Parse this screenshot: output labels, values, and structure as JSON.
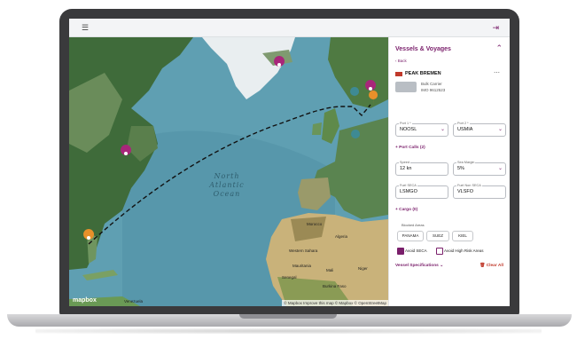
{
  "appbar": {
    "menu_icon": "menu-icon",
    "logout_icon": "logout-icon"
  },
  "map": {
    "ocean_label": [
      "North",
      "Atlantic",
      "Ocean"
    ],
    "places": {
      "algeria": "Algeria",
      "morocco": "Morocco",
      "mauritania": "Mauritania",
      "mali": "Mali",
      "niger": "Niger",
      "burkina_faso": "Burkina Faso",
      "senegal": "Senegal",
      "venezuela": "Venezuela",
      "western_sahara": "Western Sahara"
    },
    "attribution": "© Mapbox Improve this map © Mapbox © OpenStreetMap",
    "logo": "mapbox"
  },
  "panel": {
    "title": "Vessels & Voyages",
    "back": "Back",
    "vessel_name": "PEAK BREMEN",
    "vessel_type": "Bulk Carrier",
    "vessel_imo": "IMO 9612523",
    "port1": {
      "label": "Port 1 *",
      "value": "NOOSL"
    },
    "port2": {
      "label": "Port 2 *",
      "value": "USMIA"
    },
    "port_calls": "Port Calls (2)",
    "speed": {
      "label": "Speed",
      "value": "12 kn"
    },
    "sea_margin": {
      "label": "Sea Margin",
      "value": "5%"
    },
    "fuel_seca": {
      "label": "Fuel SECA",
      "value": "LSMGO"
    },
    "fuel_non_seca": {
      "label": "Fuel Non SECA",
      "value": "VLSFO"
    },
    "cargo": "Cargo (0)",
    "blocked_areas_label": "Blocked Areas",
    "blocked_areas": [
      "PANAMA",
      "SUEZ",
      "KIEL"
    ],
    "avoid_seca": "Avoid SECA",
    "avoid_high_risk": "Avoid High Risk Areas",
    "vessel_specs": "Vessel Specifications",
    "clear_all": "Clear All"
  },
  "colors": {
    "accent": "#7a1f6b",
    "marker_pink": "#a8267a",
    "marker_orange": "#e8902a",
    "marker_teal": "#3e8a93"
  }
}
